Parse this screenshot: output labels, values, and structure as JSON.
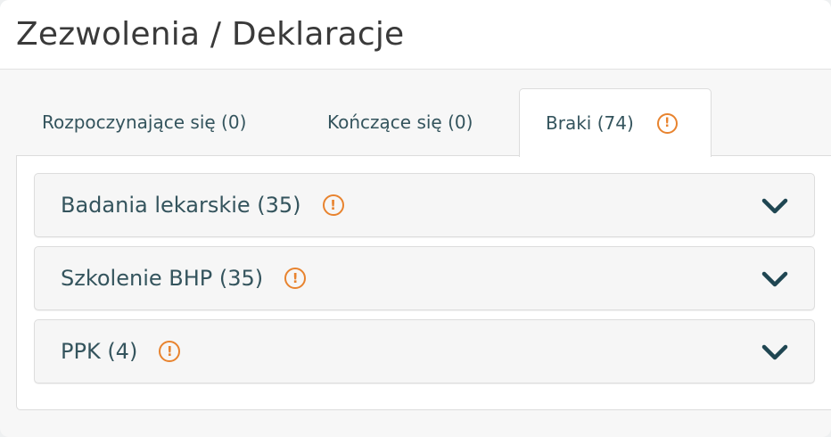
{
  "panel": {
    "title": "Zezwolenia / Deklaracje"
  },
  "tabs": [
    {
      "label": "Rozpoczynające się (0)",
      "active": false
    },
    {
      "label": "Kończące się (0)",
      "active": false
    },
    {
      "label": "Braki (74)",
      "active": true,
      "icon": "warning-icon"
    }
  ],
  "accordion": [
    {
      "label": "Badania lekarskie (35)",
      "icon": "warning-icon",
      "toggle_icon": "chevron-down-icon"
    },
    {
      "label": "Szkolenie BHP (35)",
      "icon": "warning-icon",
      "toggle_icon": "chevron-down-icon"
    },
    {
      "label": "PPK (4)",
      "icon": "warning-icon",
      "toggle_icon": "chevron-down-icon"
    }
  ],
  "colors": {
    "text_teal": "#34545d",
    "warning_orange": "#e8832e",
    "chevron": "#1f4652"
  },
  "icons": {
    "warning_glyph": "!"
  }
}
